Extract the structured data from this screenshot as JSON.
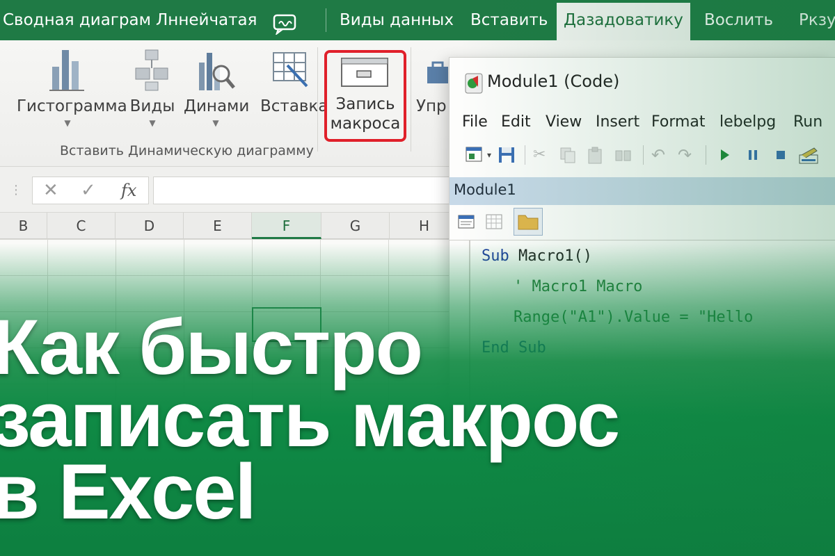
{
  "tabs": [
    "Сводная диаграм",
    "Лннейчатая",
    "Виды данных",
    "Вставить",
    "Дазадоватику",
    "Вослить",
    "Ркзу"
  ],
  "active_tab_index": 4,
  "ribbon": {
    "buttons": [
      "Гистограмма",
      "Виды",
      "Динами",
      "Вставка",
      "Упр"
    ],
    "record_macro": [
      "Запись",
      "макроса"
    ],
    "group_label": "Вставить Динамическую диаграмму"
  },
  "formula_bar": {
    "cancel": "✕",
    "confirm": "✓",
    "fx": "fx"
  },
  "columns": [
    "B",
    "C",
    "D",
    "E",
    "F",
    "G",
    "H"
  ],
  "selected_column": "F",
  "vba": {
    "title": "Module1 (Code)",
    "menu": [
      "File",
      "Edit",
      "View",
      "Insert",
      "Format",
      "lebelpg",
      "Run"
    ],
    "module_name": "Module1",
    "code": {
      "line1_kw": "Sub",
      "line1_rest": " Macro1()",
      "line2": "' Macro1 Macro",
      "line3_a": "Range(\"A1\").Value = ",
      "line3_b": "\"Hello",
      "line4": "End Sub"
    }
  },
  "headline": [
    "Как быстро",
    "записать макрос",
    "в Excel"
  ],
  "colors": {
    "excel_green": "#1f7a45",
    "record_highlight": "#e0202a",
    "module_bar": "#c7d9e8"
  }
}
